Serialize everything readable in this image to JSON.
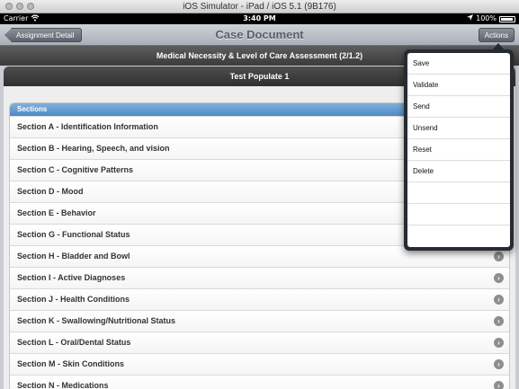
{
  "simulator": {
    "title": "iOS Simulator - iPad / iOS 5.1 (9B176)"
  },
  "status_bar": {
    "carrier": "Carrier",
    "time": "3:40 PM",
    "battery": "100%"
  },
  "navbar": {
    "back_label": "Assignment Detail",
    "title": "Case Document",
    "actions_label": "Actions"
  },
  "document_title": "Medical Necessity & Level of Care Assessment (2/1.2)",
  "populate_title": "Test Populate 1",
  "sections": {
    "header": "Sections",
    "items": [
      "Section A - Identification Information",
      "Section B - Hearing, Speech, and vision",
      "Section C - Cognitive Patterns",
      "Section D - Mood",
      "Section E - Behavior",
      "Section G - Functional Status",
      "Section H - Bladder and Bowl",
      "Section I - Active Diagnoses",
      "Section J - Health Conditions",
      "Section K - Swallowing/Nutritional Status",
      "Section L - Oral/Dental Status",
      "Section M - Skin Conditions",
      "Section N - Medications"
    ]
  },
  "actions_menu": {
    "items": [
      "Save",
      "Validate",
      "Send",
      "Unsend",
      "Reset",
      "Delete",
      "",
      "",
      ""
    ]
  },
  "colors": {
    "section_header": "#4f8ac6",
    "popover": "#262b33",
    "navbar": "#a9afb8"
  },
  "icons": [
    "wifi-icon",
    "location-icon",
    "battery-icon",
    "chevron-right-icon"
  ]
}
